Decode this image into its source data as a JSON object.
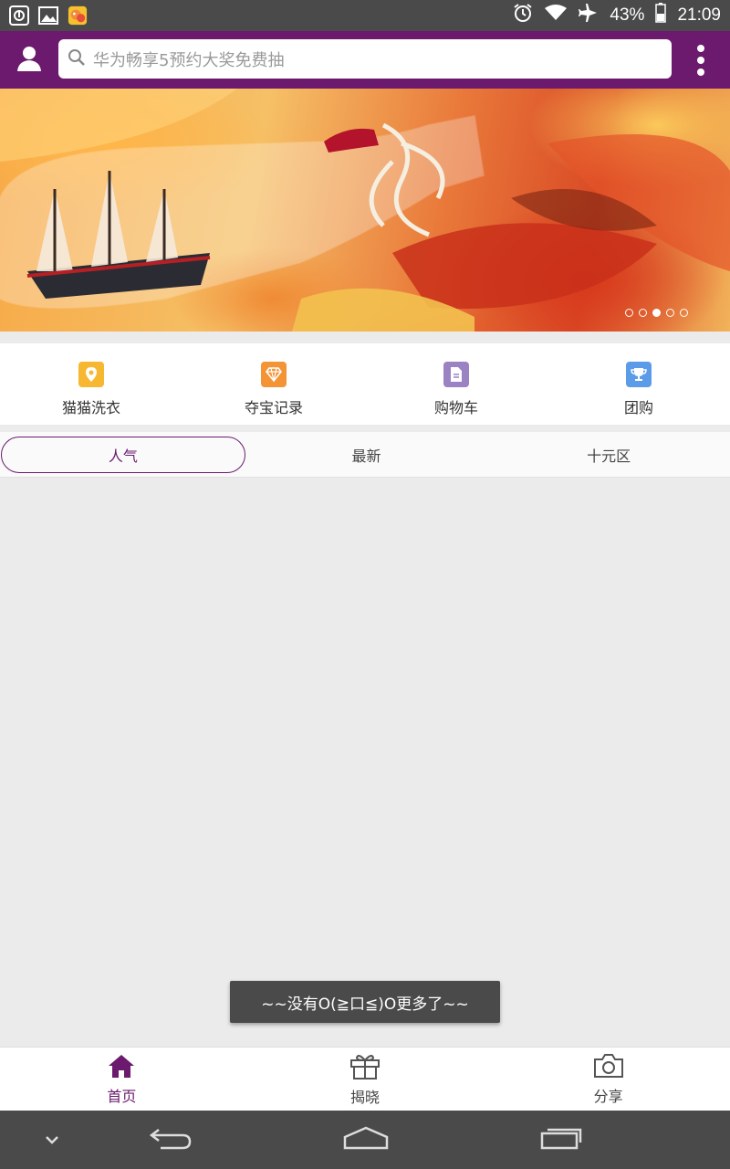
{
  "status_bar": {
    "battery": "43%",
    "time": "21:09"
  },
  "search": {
    "placeholder": "华为畅享5预约大奖免费抽"
  },
  "banner": {
    "slide_count": 5,
    "active_slide": 3
  },
  "quick_nav": [
    {
      "label": "猫猫洗衣",
      "icon": "location-pin-icon",
      "color": "#f7b731"
    },
    {
      "label": "夺宝记录",
      "icon": "diamond-icon",
      "color": "#f39437"
    },
    {
      "label": "购物车",
      "icon": "document-icon",
      "color": "#9b82c2"
    },
    {
      "label": "团购",
      "icon": "trophy-icon",
      "color": "#5b9be8"
    }
  ],
  "tabs": [
    {
      "label": "人气",
      "active": true
    },
    {
      "label": "最新",
      "active": false
    },
    {
      "label": "十元区",
      "active": false
    }
  ],
  "toast": "~~没有O(≧口≦)O更多了~~",
  "bottom_nav": [
    {
      "label": "首页",
      "icon": "home-icon",
      "active": true
    },
    {
      "label": "揭晓",
      "icon": "gift-icon",
      "active": false
    },
    {
      "label": "分享",
      "icon": "camera-icon",
      "active": false
    }
  ],
  "colors": {
    "brand": "#6b1a6e",
    "status_bar": "#4a4a4a",
    "background": "#ebebeb"
  }
}
